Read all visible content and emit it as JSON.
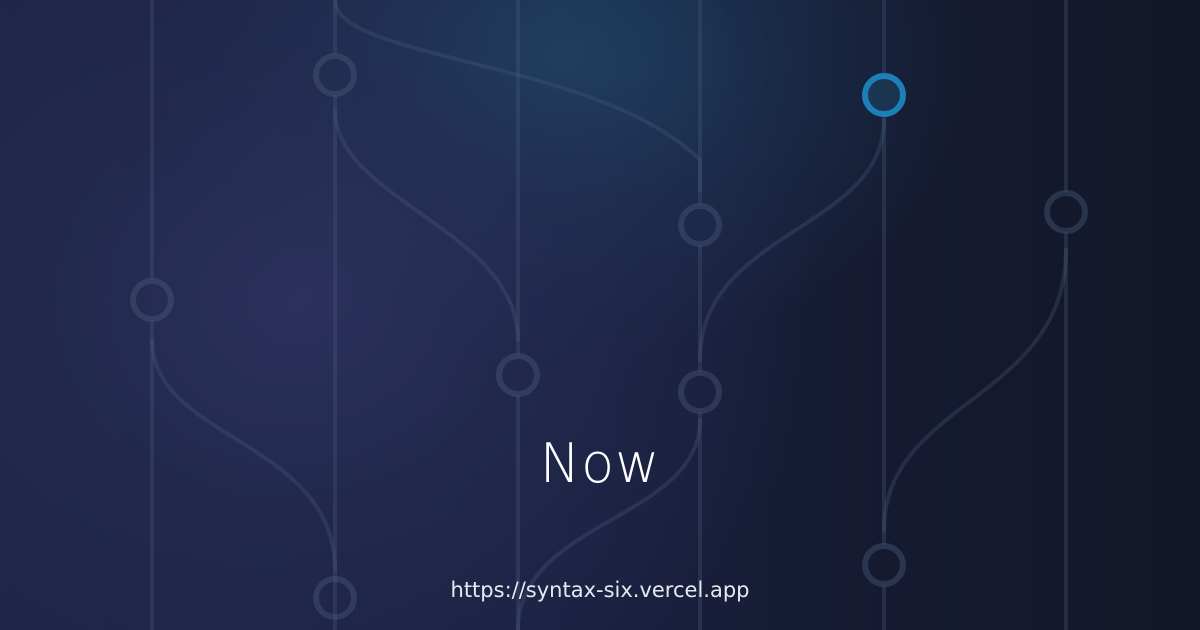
{
  "title": "Now",
  "url": "https://syntax-six.vercel.app",
  "colors": {
    "background": "#121729",
    "rail": "#4a5a7a",
    "active_node": "#1c7fb8",
    "title_text": "#ffffff",
    "url_text": "#e6e9f2"
  },
  "icons": {
    "background": "git-branch-graph",
    "highlighted_node": "commit-node-active"
  }
}
